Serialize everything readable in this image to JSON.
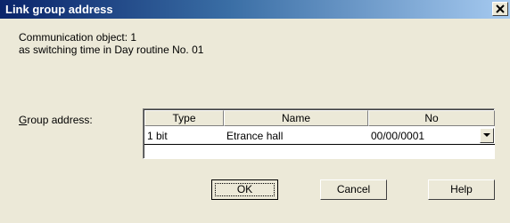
{
  "window": {
    "title": "Link group address",
    "close_glyph": "✕"
  },
  "info": {
    "line1": "Communication object: 1",
    "line2": "as switching time in Day routine No. 01"
  },
  "group_address": {
    "label_accel": "G",
    "label_rest": "roup address:",
    "columns": [
      "Type",
      "Name",
      "No"
    ],
    "row": {
      "type": "1 bit",
      "name": "Etrance hall",
      "no": "00/00/0001"
    }
  },
  "buttons": {
    "ok": "OK",
    "cancel": "Cancel",
    "help": "Help"
  },
  "icons": {
    "close": "close-icon",
    "dropdown": "chevron-down-icon"
  }
}
